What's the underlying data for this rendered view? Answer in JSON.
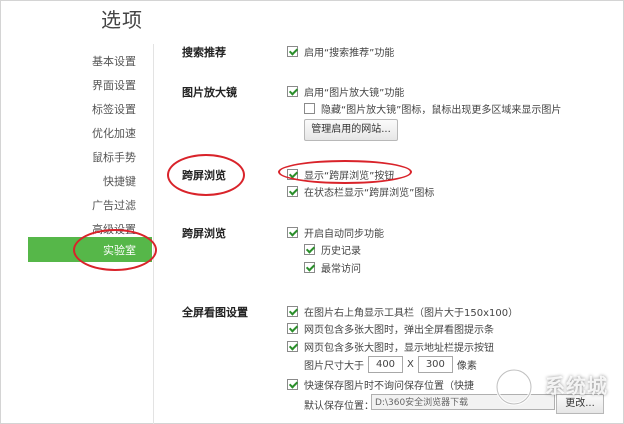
{
  "window": {
    "title": "选项"
  },
  "sidebar": {
    "items": [
      {
        "label": "基本设置"
      },
      {
        "label": "界面设置"
      },
      {
        "label": "标签设置"
      },
      {
        "label": "优化加速"
      },
      {
        "label": "鼠标手势"
      },
      {
        "label": "快捷键"
      },
      {
        "label": "广告过滤"
      },
      {
        "label": "高级设置"
      },
      {
        "label": "实验室"
      }
    ],
    "active_index": 8,
    "accent_color": "#56b749"
  },
  "sections": {
    "search": {
      "title": "搜索推荐",
      "options": [
        {
          "label": "启用“搜索推荐”功能",
          "checked": true
        }
      ]
    },
    "magnifier": {
      "title": "图片放大镜",
      "options": [
        {
          "label": "启用“图片放大镜”功能",
          "checked": true
        },
        {
          "label": "隐藏“图片放大镜”图标，鼠标出现更多区域来显示图片",
          "checked": false
        }
      ],
      "manage_button": "管理启用的网站..."
    },
    "cross_screen_1": {
      "title": "跨屏浏览",
      "options": [
        {
          "label": "显示“跨屏浏览”按钮",
          "checked": true
        },
        {
          "label": "在状态栏显示“跨屏浏览”图标",
          "checked": true
        }
      ]
    },
    "cross_screen_2": {
      "title": "跨屏浏览",
      "options": [
        {
          "label": "开启自动同步功能",
          "checked": true
        },
        {
          "label": "历史记录",
          "checked": true
        },
        {
          "label": "最常访问",
          "checked": true
        }
      ]
    },
    "fullscreen_image": {
      "title": "全屏看图设置",
      "options": [
        {
          "label": "在图片右上角显示工具栏（图片大于150x100）",
          "checked": true
        },
        {
          "label": "网页包含多张大图时，弹出全屏看图提示条",
          "checked": true
        },
        {
          "label": "网页包含多张大图时，显示地址栏提示按钮",
          "checked": true
        },
        {
          "label": "快速保存图片时不询问保存位置（快捷",
          "checked": true
        }
      ],
      "size_label": "图片尺寸大于",
      "width_value": "400",
      "times": "X",
      "height_value": "300",
      "unit": "像素",
      "save_location_label": "默认保存位置：",
      "save_path": "D:\\360安全浏览器下载",
      "change_button": "更改..."
    }
  },
  "watermark": {
    "text": "系统城"
  },
  "annotation_color": "#d9232a"
}
